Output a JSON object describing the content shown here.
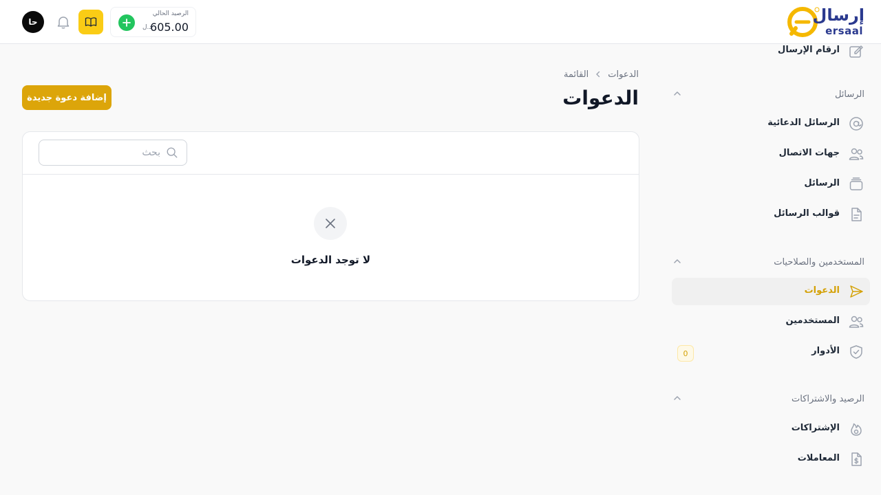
{
  "brand": {
    "name_ar": "إرسال",
    "name_en": "ersaal"
  },
  "header": {
    "balance_label": "الرصيد الحالي",
    "balance_amount": "605.00",
    "balance_currency": "د.ل",
    "avatar_initials": "حا"
  },
  "sidebar": {
    "top_item": "ارقام الإرسال",
    "sections": [
      {
        "label": "الرسائل",
        "items": [
          "الرسائل الدعائية",
          "جهات الاتصال",
          "الرسائل",
          "قوالب الرسائل"
        ]
      },
      {
        "label": "المستخدمين والصلاحيات",
        "items": [
          "الدعوات",
          "المستخدمين",
          "الأدوار"
        ]
      },
      {
        "label": "الرصيد والاشتراكات",
        "items": [
          "الإشتراكات",
          "المعاملات"
        ]
      }
    ],
    "active_item": "الدعوات",
    "roles_badge": "0"
  },
  "breadcrumb": [
    "الدعوات",
    "القائمة"
  ],
  "page": {
    "title": "الدعوات",
    "add_button": "إضافة دعوة جديدة",
    "search_placeholder": "بحث",
    "search_value": "",
    "empty_message": "لا توجد الدعوات"
  },
  "colors": {
    "accent": "#dca50a",
    "brand_blue": "#2b3a8f",
    "brand_yellow": "#f5b800",
    "success": "#22c55e"
  }
}
